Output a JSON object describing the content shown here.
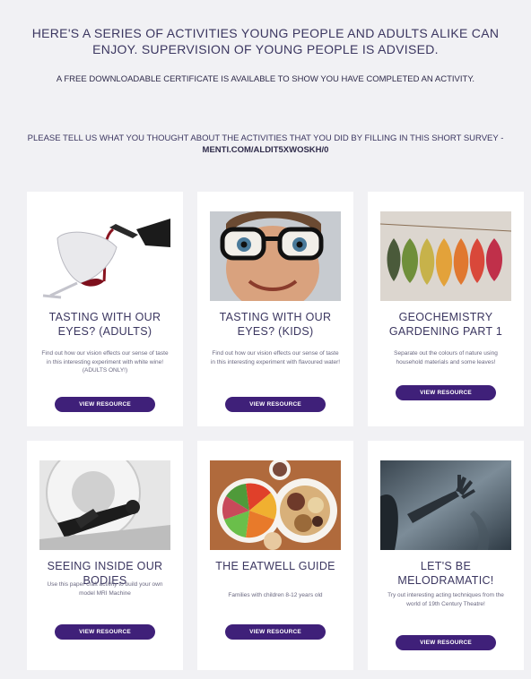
{
  "intro": {
    "headline": "HERE'S A SERIES OF ACTIVITIES YOUNG PEOPLE AND ADULTS ALIKE CAN ENJOY. SUPERVISION OF YOUNG PEOPLE IS ADVISED.",
    "certificate": "A FREE DOWNLOADABLE CERTIFICATE IS AVAILABLE TO SHOW YOU HAVE COMPLETED AN ACTIVITY.",
    "survey_text": "PLEASE TELL US WHAT YOU THOUGHT ABOUT THE ACTIVITIES THAT YOU DID BY FILLING IN THIS SHORT SURVEY - ",
    "survey_link": "MENTI.COM/ALDIT5XWOSKH/0"
  },
  "cards": [
    {
      "title": "TASTING WITH OUR EYES? (ADULTS)",
      "description": "Find out how our vision effects our sense of taste in this interesting experiment with white wine! (ADULTS ONLY!)",
      "button": "VIEW RESOURCE",
      "image": "wine-pour-image"
    },
    {
      "title": "TASTING WITH OUR EYES? (KIDS)",
      "description": "Find out how our vision effects our sense of taste in this interesting experiment with flavoured water!",
      "button": "VIEW RESOURCE",
      "image": "child-glasses-image"
    },
    {
      "title": "GEOCHEMISTRY GARDENING PART 1",
      "description": "Separate out the colours of nature using household materials and some leaves!",
      "button": "VIEW RESOURCE",
      "image": "autumn-leaves-image"
    },
    {
      "title": "SEEING INSIDE OUR BODIES",
      "description": "Use this paper craft activity to build your own model MRI Machine",
      "button": "VIEW RESOURCE",
      "image": "mri-scanner-image"
    },
    {
      "title": "THE EATWELL GUIDE",
      "description": "Families with children 8-12 years old",
      "button": "VIEW RESOURCE",
      "image": "food-plates-image"
    },
    {
      "title": "LET'S BE MELODRAMATIC!",
      "description": "Try out interesting acting techniques from the world of 19th Century Theatre!",
      "button": "VIEW RESOURCE",
      "image": "melodrama-hand-image"
    }
  ],
  "colors": {
    "page_bg": "#f1f1f4",
    "card_bg": "#ffffff",
    "button_bg": "#3f2079",
    "heading_text": "#3b3660"
  }
}
